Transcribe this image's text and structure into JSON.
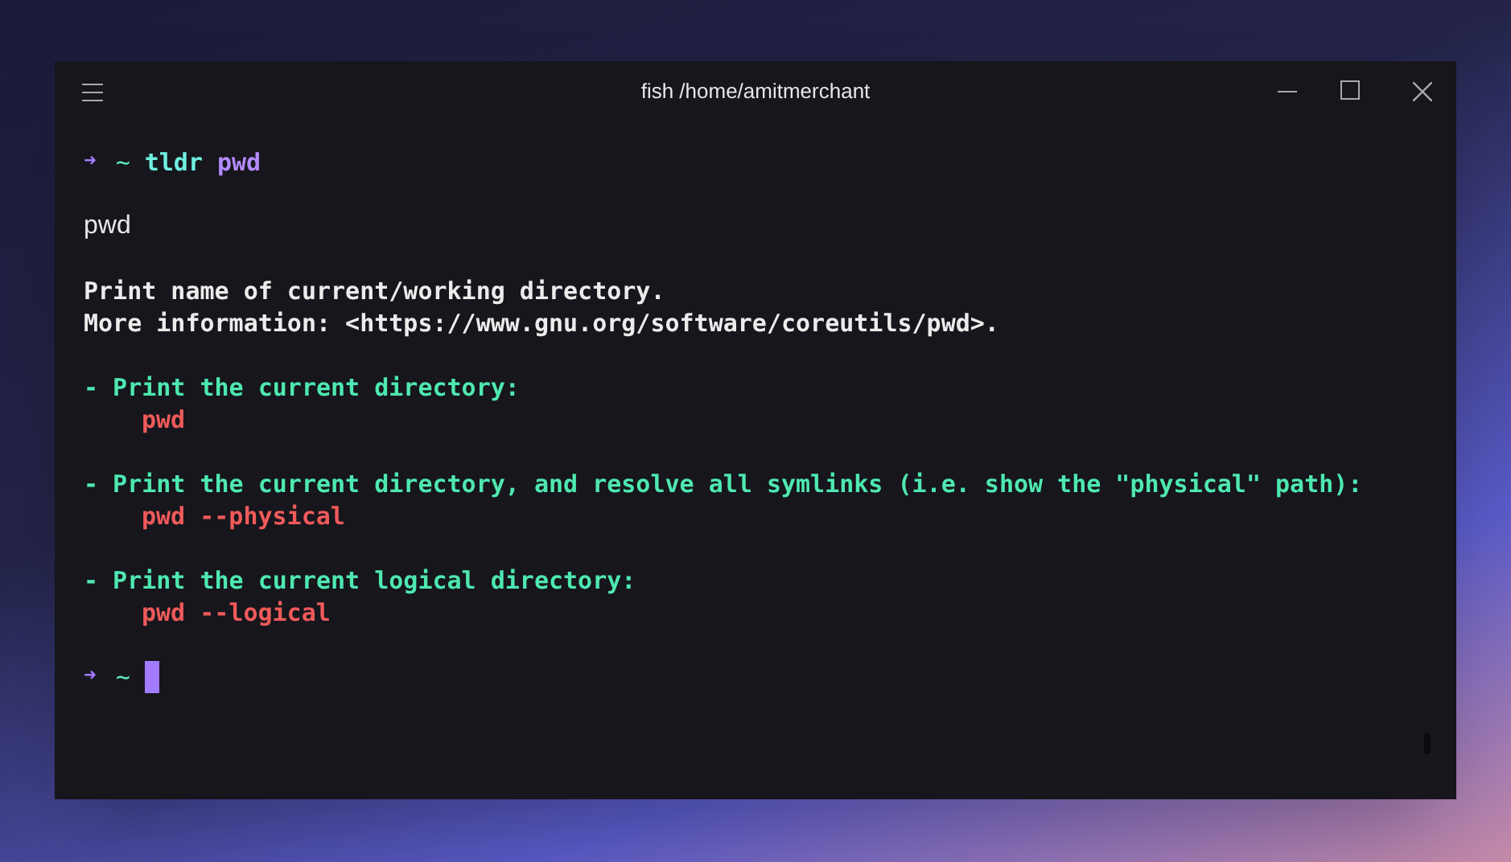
{
  "window": {
    "title": "fish /home/amitmerchant"
  },
  "blocks": [
    [
      [
        {
          "kind": "arrow",
          "text": "➜"
        },
        {
          "kind": "tilde",
          "text": "~"
        },
        {
          "kind": "command",
          "text": "tldr"
        },
        {
          "kind": "argument",
          "text": "pwd"
        }
      ]
    ],
    [
      [
        {
          "kind": "plain",
          "text": "pwd"
        }
      ]
    ],
    [
      [
        {
          "kind": "heading",
          "text": "Print name of current/working directory."
        }
      ],
      [
        {
          "kind": "heading",
          "text": "More information: <https://www.gnu.org/software/coreutils/pwd>."
        }
      ]
    ],
    [
      [
        {
          "kind": "description",
          "text": "- Print the current directory:"
        }
      ],
      [
        {
          "kind": "example",
          "text": "pwd"
        }
      ]
    ],
    [
      [
        {
          "kind": "description",
          "text": "- Print the current directory, and resolve all symlinks (i.e. show the \"physical\" path):"
        }
      ],
      [
        {
          "kind": "example",
          "text": "pwd --physical"
        }
      ]
    ],
    [
      [
        {
          "kind": "description",
          "text": "- Print the current logical directory:"
        }
      ],
      [
        {
          "kind": "example",
          "text": "pwd --logical"
        }
      ]
    ],
    [
      [
        {
          "kind": "arrow",
          "text": "➜"
        },
        {
          "kind": "tilde",
          "text": "~"
        },
        {
          "kind": "cursor"
        }
      ]
    ]
  ]
}
